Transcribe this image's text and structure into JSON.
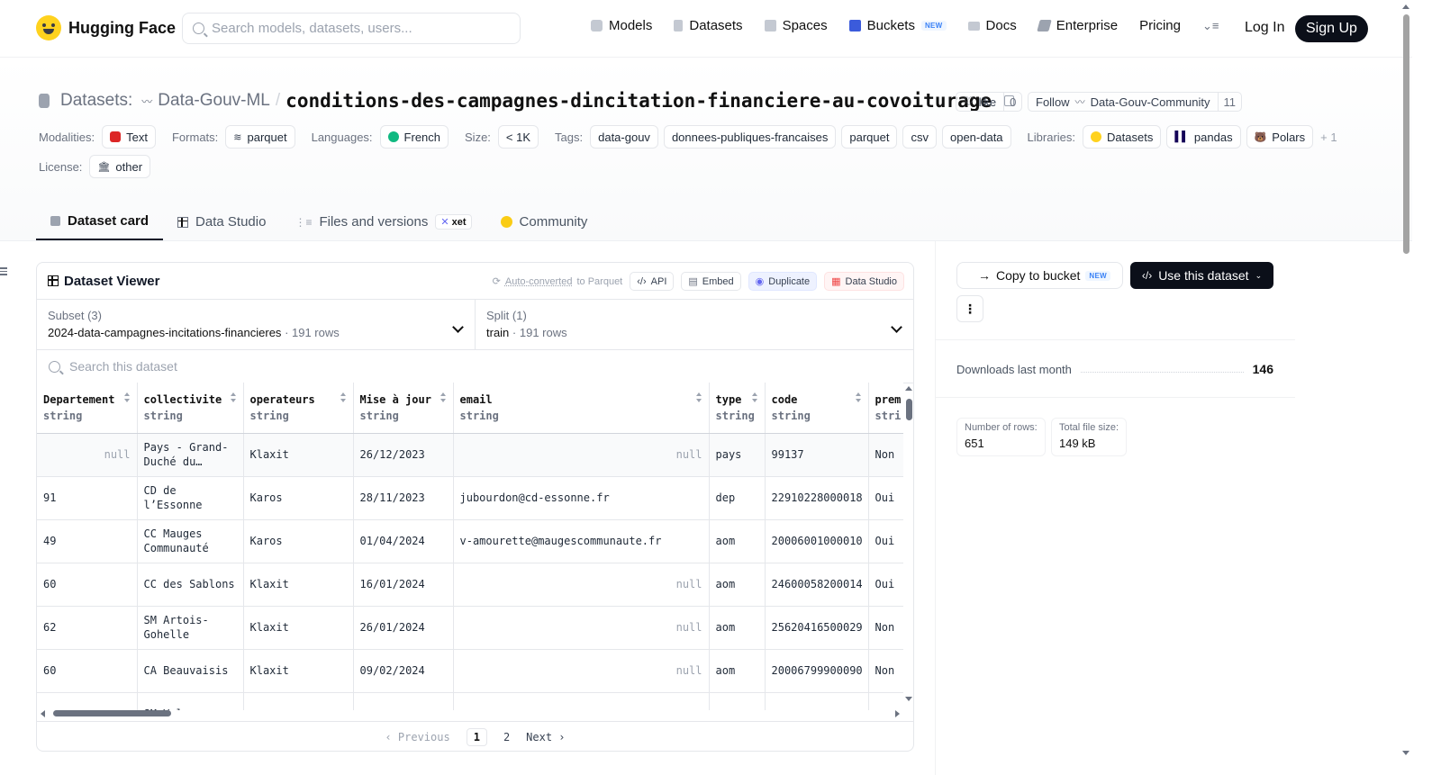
{
  "nav": {
    "brand": "Hugging Face",
    "search_placeholder": "Search models, datasets, users...",
    "links": [
      "Models",
      "Datasets",
      "Spaces",
      "Buckets",
      "Docs",
      "Enterprise",
      "Pricing"
    ],
    "new_badge": "NEW",
    "login": "Log In",
    "signup": "Sign Up"
  },
  "header": {
    "crumb_label": "Datasets:",
    "org": "Data-Gouv-ML",
    "sep": "/",
    "repo": "conditions-des-campagnes-dincitation-financiere-au-covoiturage",
    "like_label": "like",
    "like_count": "0",
    "follow_label": "Follow",
    "follow_org": "Data-Gouv-Community",
    "follow_count": "11"
  },
  "tags": {
    "modalities_label": "Modalities:",
    "modality": "Text",
    "formats_label": "Formats:",
    "format": "parquet",
    "languages_label": "Languages:",
    "language": "French",
    "size_label": "Size:",
    "size": "< 1K",
    "tags_label": "Tags:",
    "tag_list": [
      "data-gouv",
      "donnees-publiques-francaises",
      "parquet",
      "csv",
      "open-data"
    ],
    "libraries_label": "Libraries:",
    "libraries": [
      "Datasets",
      "pandas",
      "Polars"
    ],
    "libraries_more": "+ 1",
    "license_label": "License:",
    "license": "other"
  },
  "tabs": {
    "dataset_card": "Dataset card",
    "data_studio": "Data Studio",
    "files": "Files and versions",
    "xet": "xet",
    "community": "Community"
  },
  "viewer": {
    "title": "Dataset Viewer",
    "auto_converted": "Auto-converted",
    "to_parquet": "to Parquet",
    "api": "API",
    "embed": "Embed",
    "duplicate": "Duplicate",
    "data_studio": "Data Studio",
    "subset_label": "Subset (3)",
    "subset_value": "2024-data-campagnes-incitations-financieres",
    "subset_rows": "· 191 rows",
    "split_label": "Split (1)",
    "split_value": "train",
    "split_rows": "· 191 rows",
    "search_placeholder": "Search this dataset",
    "columns": [
      {
        "name": "Departement",
        "type": "string"
      },
      {
        "name": "collectivite",
        "type": "string"
      },
      {
        "name": "operateurs",
        "type": "string"
      },
      {
        "name": "Mise à jour",
        "type": "string"
      },
      {
        "name": "email",
        "type": "string"
      },
      {
        "name": "type",
        "type": "string"
      },
      {
        "name": "code",
        "type": "string"
      },
      {
        "name": "prem",
        "type": "stri"
      }
    ],
    "rows": [
      [
        "null",
        "Pays - Grand-Duché du…",
        "Klaxit",
        "26/12/2023",
        "null",
        "pays",
        "99137",
        "Non"
      ],
      [
        "91",
        "CD de l’Essonne",
        "Karos",
        "28/11/2023",
        "jubourdon@cd-essonne.fr",
        "dep",
        "22910228000018",
        "Oui"
      ],
      [
        "49",
        "CC Mauges Communauté",
        "Karos",
        "01/04/2024",
        "v-amourette@maugescommunaute.fr",
        "aom",
        "20006001000010",
        "Oui"
      ],
      [
        "60",
        "CC des Sablons",
        "Klaxit",
        "16/01/2024",
        "null",
        "aom",
        "24600058200014",
        "Oui"
      ],
      [
        "62",
        "SM Artois-Gohelle",
        "Klaxit",
        "26/01/2024",
        "null",
        "aom",
        "25620416500029",
        "Non"
      ],
      [
        "60",
        "CA Beauvaisis",
        "Klaxit",
        "09/02/2024",
        "null",
        "aom",
        "20006799900090",
        "Non"
      ],
      [
        "",
        "SM Valence",
        "",
        "",
        "",
        "",
        "",
        ""
      ]
    ],
    "pager": {
      "prev": "Previous",
      "pages": [
        "1",
        "2"
      ],
      "next": "Next"
    }
  },
  "sidebar": {
    "copy_bucket": "Copy to bucket",
    "new_badge": "NEW",
    "use_dataset": "Use this dataset",
    "kebab": "⋮",
    "downloads_label": "Downloads last month",
    "downloads_value": "146",
    "rows_label": "Number of rows:",
    "rows_value": "651",
    "size_label": "Total file size:",
    "size_value": "149 kB"
  }
}
